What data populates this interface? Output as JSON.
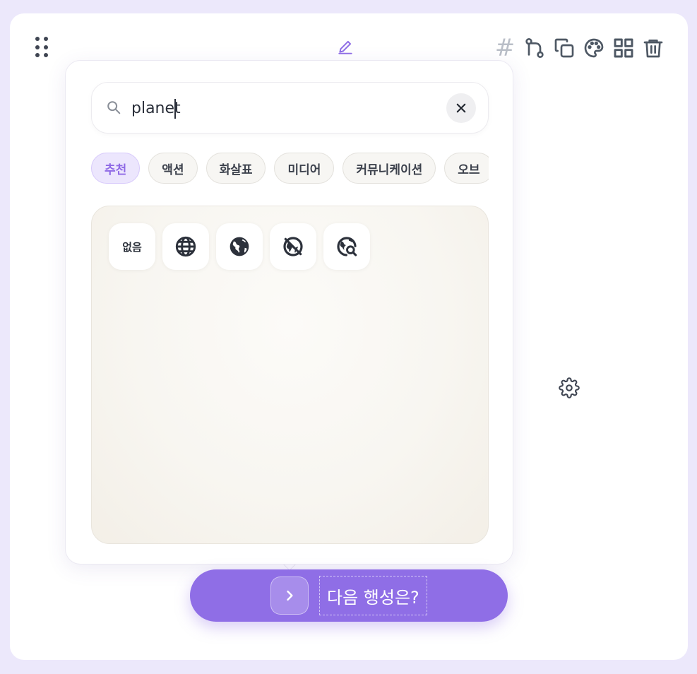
{
  "toolbar": {
    "hash_label": "#",
    "icons": [
      "edit-icon",
      "git-branch-icon",
      "copy-icon",
      "palette-icon",
      "grid-icon",
      "trash-icon",
      "gear-icon",
      "drag-handle-icon"
    ]
  },
  "icon_picker": {
    "search": {
      "value": "planet",
      "placeholder": ""
    },
    "categories": [
      "추천",
      "액션",
      "화살표",
      "미디어",
      "커뮤니케이션",
      "오브"
    ],
    "active_category": "추천",
    "none_label": "없음",
    "results": [
      "globe-icon",
      "public-globe-icon",
      "globe-off-icon",
      "globe-search-icon"
    ]
  },
  "action_bar": {
    "prompt": "다음 행성은?"
  },
  "colors": {
    "accent": "#8f6ee6",
    "chip_active_bg": "#ece6fd",
    "page_bg": "#ece8fb"
  }
}
